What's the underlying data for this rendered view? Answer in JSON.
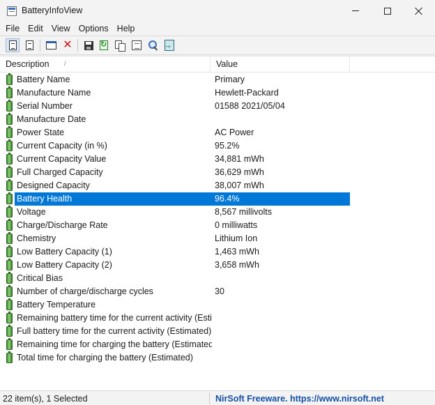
{
  "window": {
    "title": "BatteryInfoView",
    "icons": {
      "app": "app-window-icon",
      "minimize": "minimize-icon",
      "maximize": "maximize-icon",
      "close": "close-icon"
    }
  },
  "menubar": {
    "items": [
      {
        "label": "File"
      },
      {
        "label": "Edit"
      },
      {
        "label": "View"
      },
      {
        "label": "Options"
      },
      {
        "label": "Help"
      }
    ]
  },
  "toolbar": {
    "buttons": [
      {
        "icon": "battery-info-mode-icon",
        "pressed": true
      },
      {
        "icon": "battery-log-mode-icon",
        "pressed": false
      },
      {
        "icon": "window-icon",
        "pressed": false
      },
      {
        "icon": "delete-icon",
        "pressed": false
      },
      {
        "icon": "save-icon",
        "pressed": false
      },
      {
        "icon": "refresh-icon",
        "pressed": false
      },
      {
        "icon": "copy-icon",
        "pressed": false
      },
      {
        "icon": "properties-icon",
        "pressed": false
      },
      {
        "icon": "find-icon",
        "pressed": false
      },
      {
        "icon": "exit-icon",
        "pressed": false
      }
    ]
  },
  "list": {
    "columns": {
      "description": "Description",
      "value": "Value"
    },
    "sort_indicator": "/",
    "selection_color": "#0078d7",
    "row_icon": "battery-icon",
    "rows": [
      {
        "description": "Battery Name",
        "value": "Primary"
      },
      {
        "description": "Manufacture Name",
        "value": "Hewlett-Packard"
      },
      {
        "description": "Serial Number",
        "value": "01588 2021/05/04"
      },
      {
        "description": "Manufacture Date",
        "value": ""
      },
      {
        "description": "Power State",
        "value": "AC Power"
      },
      {
        "description": "Current Capacity (in %)",
        "value": "95.2%"
      },
      {
        "description": "Current Capacity Value",
        "value": "34,881 mWh"
      },
      {
        "description": "Full Charged Capacity",
        "value": "36,629 mWh"
      },
      {
        "description": "Designed Capacity",
        "value": "38,007 mWh"
      },
      {
        "description": "Battery Health",
        "value": "96.4%",
        "selected": true
      },
      {
        "description": "Voltage",
        "value": "8,567 millivolts"
      },
      {
        "description": "Charge/Discharge Rate",
        "value": "0 milliwatts"
      },
      {
        "description": "Chemistry",
        "value": "Lithium Ion"
      },
      {
        "description": "Low Battery Capacity (1)",
        "value": "1,463 mWh"
      },
      {
        "description": "Low Battery Capacity (2)",
        "value": "3,658 mWh"
      },
      {
        "description": "Critical Bias",
        "value": ""
      },
      {
        "description": "Number of charge/discharge cycles",
        "value": "30"
      },
      {
        "description": "Battery Temperature",
        "value": ""
      },
      {
        "description": "Remaining battery time for the current activity (Esti...",
        "value": ""
      },
      {
        "description": "Full battery time for the current activity (Estimated)",
        "value": ""
      },
      {
        "description": "Remaining time for charging the battery (Estimated)",
        "value": ""
      },
      {
        "description": "Total  time for charging the battery (Estimated)",
        "value": ""
      }
    ]
  },
  "statusbar": {
    "items_text": "22 item(s), 1 Selected",
    "credit_text": "NirSoft Freeware. https://www.nirsoft.net",
    "credit_color": "#1450a6"
  }
}
